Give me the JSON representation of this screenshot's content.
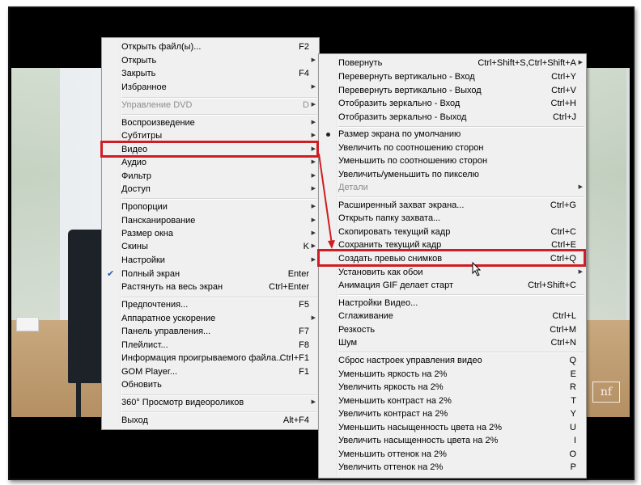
{
  "menu_left": {
    "items": [
      {
        "label": "Открыть файл(ы)...",
        "shortcut": "F2",
        "submenu": false
      },
      {
        "label": "Открыть",
        "shortcut": "",
        "submenu": true
      },
      {
        "label": "Закрыть",
        "shortcut": "F4",
        "submenu": false
      },
      {
        "label": "Избранное",
        "shortcut": "",
        "submenu": true
      },
      {
        "label": "Управление DVD",
        "shortcut": "D",
        "submenu": true,
        "disabled": true
      },
      {
        "label": "Воспроизведение",
        "shortcut": "",
        "submenu": true
      },
      {
        "label": "Субтитры",
        "shortcut": "",
        "submenu": true
      },
      {
        "label": "Видео",
        "shortcut": "",
        "submenu": true,
        "highlighted": true
      },
      {
        "label": "Аудио",
        "shortcut": "",
        "submenu": true
      },
      {
        "label": "Фильтр",
        "shortcut": "",
        "submenu": true
      },
      {
        "label": "Доступ",
        "shortcut": "",
        "submenu": true
      },
      {
        "label": "Пропорции",
        "shortcut": "",
        "submenu": true
      },
      {
        "label": "Панскан­ирование",
        "shortcut": "",
        "submenu": true
      },
      {
        "label": "Размер окна",
        "shortcut": "",
        "submenu": true
      },
      {
        "label": "Скины",
        "shortcut": "K",
        "submenu": true
      },
      {
        "label": "Настройки",
        "shortcut": "",
        "submenu": true
      },
      {
        "label": "Полный экран",
        "shortcut": "Enter",
        "submenu": false,
        "checked": true
      },
      {
        "label": "Растянуть на весь экран",
        "shortcut": "Ctrl+Enter",
        "submenu": false
      },
      {
        "label": "Предпочтения...",
        "shortcut": "F5",
        "submenu": false
      },
      {
        "label": "Аппаратное ускорение",
        "shortcut": "",
        "submenu": true
      },
      {
        "label": "Панель управления...",
        "shortcut": "F7",
        "submenu": false
      },
      {
        "label": "Плейлист...",
        "shortcut": "F8",
        "submenu": false
      },
      {
        "label": "Информация проигрываемого файла...",
        "shortcut": "Ctrl+F1",
        "submenu": false
      },
      {
        "label": "GOM Player...",
        "shortcut": "F1",
        "submenu": false
      },
      {
        "label": "Обновить",
        "shortcut": "",
        "submenu": false
      },
      {
        "label": "360° Просмотр видеороликов",
        "shortcut": "",
        "submenu": true
      },
      {
        "label": "Выход",
        "shortcut": "Alt+F4",
        "submenu": false
      }
    ]
  },
  "menu_right": {
    "items": [
      {
        "label": "Повернуть",
        "shortcut": "Ctrl+Shift+S,Ctrl+Shift+A",
        "submenu": true
      },
      {
        "label": "Перевернуть вертикально - Вход",
        "shortcut": "Ctrl+Y",
        "submenu": false
      },
      {
        "label": "Перевернуть вертикально - Выход",
        "shortcut": "Ctrl+V",
        "submenu": false
      },
      {
        "label": "Отобразить зеркально - Вход",
        "shortcut": "Ctrl+H",
        "submenu": false
      },
      {
        "label": "Отобразить зеркально - Выход",
        "shortcut": "Ctrl+J",
        "submenu": false
      },
      {
        "label": "Размер экрана по умолчанию",
        "shortcut": "",
        "submenu": false,
        "radio": true
      },
      {
        "label": "Увеличить по соотношению сторон",
        "shortcut": "",
        "submenu": false
      },
      {
        "label": "Уменьшить по соотношению сторон",
        "shortcut": "",
        "submenu": false
      },
      {
        "label": "Увеличить/уменьшить по пикселю",
        "shortcut": "",
        "submenu": false
      },
      {
        "label": "Детали",
        "shortcut": "",
        "submenu": true,
        "disabled": true
      },
      {
        "label": "Расширенный захват экрана...",
        "shortcut": "Ctrl+G",
        "submenu": false
      },
      {
        "label": "Открыть папку захвата...",
        "shortcut": "",
        "submenu": false
      },
      {
        "label": "Скопировать текущий кадр",
        "shortcut": "Ctrl+C",
        "submenu": false
      },
      {
        "label": "Сохранить текущий кадр",
        "shortcut": "Ctrl+E",
        "submenu": false
      },
      {
        "label": "Создать превью снимков",
        "shortcut": "Ctrl+Q",
        "submenu": false,
        "highlighted": true
      },
      {
        "label": "Установить как обои",
        "shortcut": "",
        "submenu": true
      },
      {
        "label": "Анимация GIF делает старт",
        "shortcut": "Ctrl+Shift+C",
        "submenu": false
      },
      {
        "label": "Настройки Видео...",
        "shortcut": "",
        "submenu": false
      },
      {
        "label": "Сглаживание",
        "shortcut": "Ctrl+L",
        "submenu": false
      },
      {
        "label": "Резкость",
        "shortcut": "Ctrl+M",
        "submenu": false
      },
      {
        "label": "Шум",
        "shortcut": "Ctrl+N",
        "submenu": false
      },
      {
        "label": "Сброс настроек управления видео",
        "shortcut": "Q",
        "submenu": false
      },
      {
        "label": "Уменьшить яркость на 2%",
        "shortcut": "E",
        "submenu": false
      },
      {
        "label": "Увеличить яркость на 2%",
        "shortcut": "R",
        "submenu": false
      },
      {
        "label": "Уменьшить контраст на 2%",
        "shortcut": "T",
        "submenu": false
      },
      {
        "label": "Увеличить контраст на 2%",
        "shortcut": "Y",
        "submenu": false
      },
      {
        "label": "Уменьшить насыщенность цвета на 2%",
        "shortcut": "U",
        "submenu": false
      },
      {
        "label": "Увеличить насыщенность цвета на 2%",
        "shortcut": "I",
        "submenu": false
      },
      {
        "label": "Уменьшить оттенок на 2%",
        "shortcut": "O",
        "submenu": false
      },
      {
        "label": "Увеличить оттенок на 2%",
        "shortcut": "P",
        "submenu": false
      }
    ]
  },
  "video": {
    "logo_text": "nf"
  },
  "colors": {
    "highlight_box": "#d01c24",
    "menu_bg": "#f0f0f0"
  }
}
